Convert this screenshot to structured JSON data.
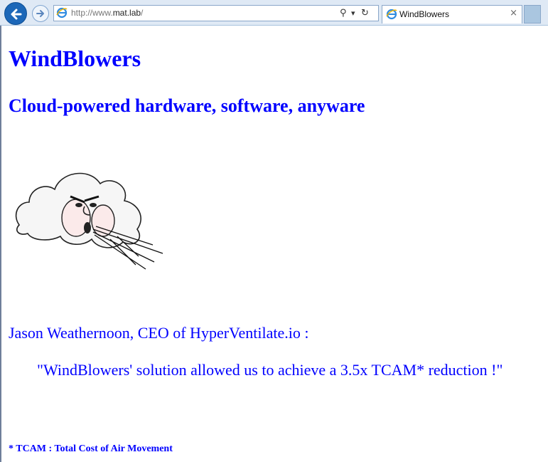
{
  "browser": {
    "url_prefix": "http://www.",
    "url_domain": "mat.lab",
    "url_suffix": "/",
    "tab_title": "WindBlowers",
    "tab_close": "×",
    "search_glyph": "⚲",
    "dropdown_glyph": "▾",
    "refresh_glyph": "↻",
    "accent_color": "#1c67b8"
  },
  "page": {
    "title": "WindBlowers",
    "tagline": "Cloud-powered hardware, software, anyware",
    "image_name": "blowing-cloud-illustration",
    "testimonial_author": "Jason Weathernoon, CEO of HyperVentilate.io :",
    "testimonial_quote": "\"WindBlowers' solution allowed us to achieve a 3.5x TCAM* reduction !\"",
    "footnote": "* TCAM : Total Cost of Air Movement",
    "text_color": "#0000ff"
  }
}
